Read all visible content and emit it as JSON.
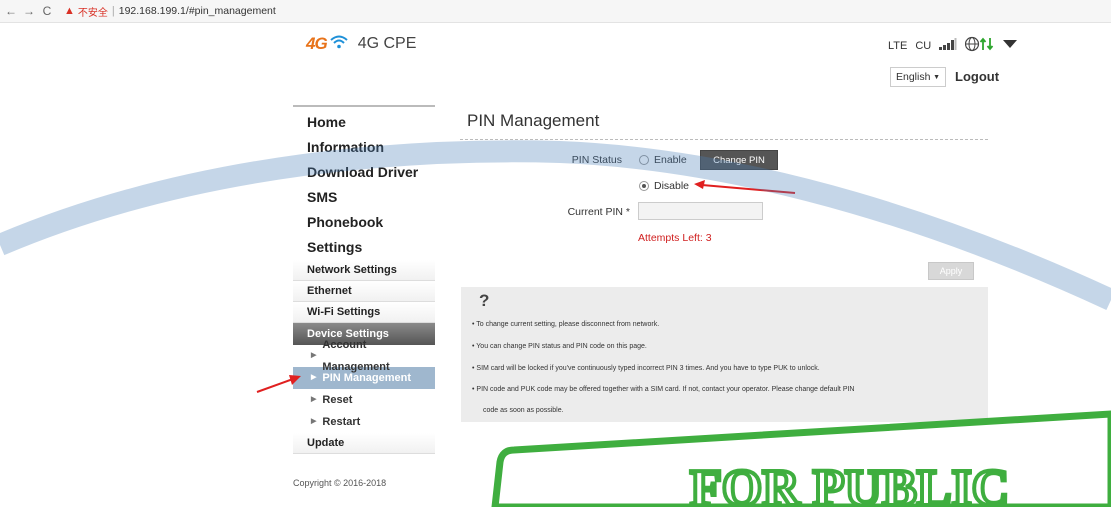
{
  "browser": {
    "back": "←",
    "forward": "→",
    "reload": "C",
    "security_warning": "不安全",
    "url": "192.168.199.1/#pin_management"
  },
  "header": {
    "logo_4g": "4G",
    "product_name": "4G CPE",
    "network_type": "LTE",
    "operator": "CU",
    "language": "English",
    "logout": "Logout"
  },
  "sidebar": {
    "main_items": [
      {
        "label": "Home"
      },
      {
        "label": "Information"
      },
      {
        "label": "Download Driver"
      },
      {
        "label": "SMS"
      },
      {
        "label": "Phonebook"
      },
      {
        "label": "Settings"
      }
    ],
    "settings_items": [
      {
        "label": "Network Settings"
      },
      {
        "label": "Ethernet"
      },
      {
        "label": "Wi-Fi Settings"
      },
      {
        "label": "Device Settings"
      }
    ],
    "device_children": [
      {
        "label": "Account Management"
      },
      {
        "label": "PIN Management"
      },
      {
        "label": "Reset"
      },
      {
        "label": "Restart"
      }
    ],
    "update": "Update"
  },
  "main": {
    "title": "PIN Management",
    "pin_status_label": "PIN Status",
    "enable_label": "Enable",
    "disable_label": "Disable",
    "selected": "Disable",
    "change_pin_button": "Change PIN",
    "current_pin_label": "Current PIN *",
    "current_pin_value": "",
    "attempts_left": "Attempts Left: 3",
    "apply_button": "Apply"
  },
  "help": {
    "icon": "?",
    "items": [
      "• To change current setting, please disconnect from network.",
      "• You can change PIN status and PIN code on this page.",
      "• SIM card will be locked if you've continuously typed incorrect PIN 3 times. And you have to type PUK to unlock.",
      "• PIN code and PUK code may be offered together with a SIM card. If not, contact your operator. Please change default PIN",
      "code as soon as possible."
    ]
  },
  "footer": {
    "copyright": "Copyright © 2016-2018"
  },
  "watermark": {
    "text": "FOR PUBLIC"
  },
  "colors": {
    "accent_orange": "#e8731a",
    "active_nav": "#9fb7ce",
    "error_red": "#d02020",
    "watermark_green": "#3fae3f"
  }
}
